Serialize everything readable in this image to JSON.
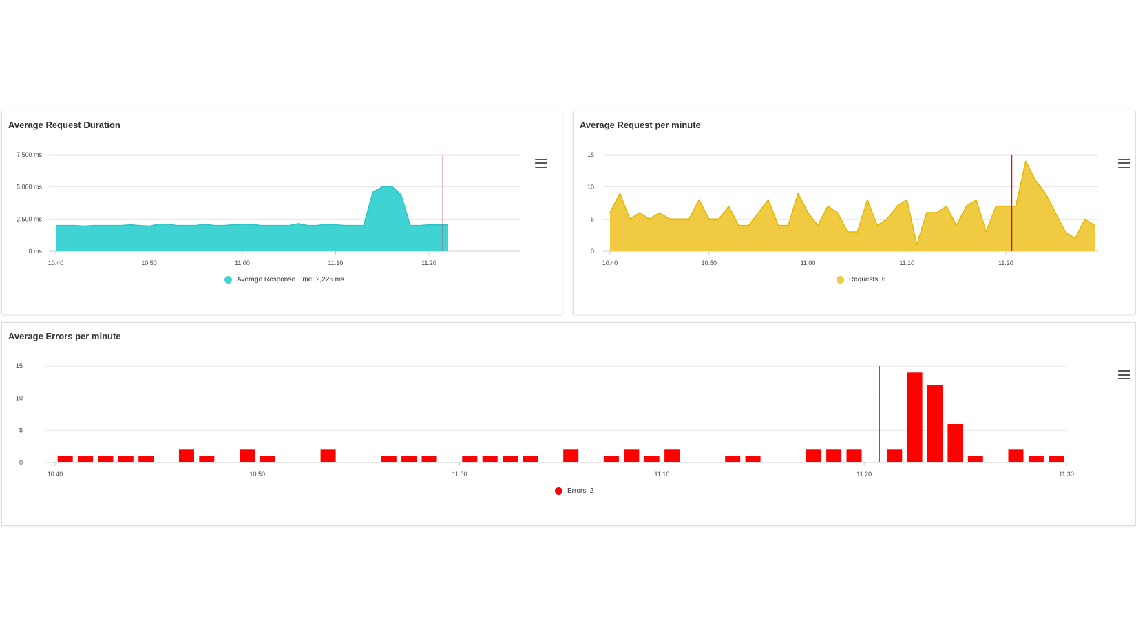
{
  "charts": {
    "duration": {
      "title": "Average Request Duration",
      "legend_label": "Average Response Time: 2,225 ms",
      "color": "#3fd3d3",
      "stroke": "#2cc4c4"
    },
    "requests": {
      "title": "Average Request per minute",
      "legend_label": "Requests: 6",
      "color": "#f0cb41",
      "stroke": "#e3b900"
    },
    "errors": {
      "title": "Average Errors per minute",
      "legend_label": "Errors: 2",
      "color": "#ff0000",
      "stroke": "#ff0000"
    },
    "marker_color": "#e8000c",
    "grid_color": "#e6e6e6"
  },
  "chart_data": [
    {
      "type": "area",
      "title": "Average Request Duration",
      "series": [
        {
          "name": "Average Response Time",
          "values": [
            2000,
            2000,
            2000,
            1950,
            2000,
            2000,
            2000,
            2000,
            2050,
            2000,
            1950,
            2100,
            2100,
            2000,
            2000,
            2000,
            2100,
            2000,
            2000,
            2050,
            2100,
            2100,
            2000,
            2000,
            2000,
            2000,
            2150,
            2000,
            2000,
            2100,
            2050,
            2000,
            2000,
            2000,
            4600,
            5000,
            5050,
            4400,
            2000,
            2000,
            2050,
            2050,
            2050
          ]
        }
      ],
      "x_start_minutes": 640,
      "x_step_minutes": 1,
      "x_ticks": [
        "10:40",
        "10:50",
        "11:00",
        "11:10",
        "11:20"
      ],
      "y_ticks": [
        "0 ms",
        "2,500 ms",
        "5,000 ms",
        "7,500 ms"
      ],
      "ylim": [
        0,
        7500
      ],
      "xlim_minutes": [
        640,
        690
      ],
      "marker_minutes": 681.5,
      "grid": true,
      "legend_placement": "bottom-center"
    },
    {
      "type": "area",
      "title": "Average Request per minute",
      "series": [
        {
          "name": "Requests",
          "values": [
            6,
            9,
            5,
            6,
            5,
            6,
            5,
            5,
            5,
            8,
            5,
            5,
            7,
            4,
            4,
            6,
            8,
            4,
            4,
            9,
            6,
            4,
            7,
            6,
            3,
            3,
            8,
            4,
            5,
            7,
            8,
            1,
            6,
            6,
            7,
            4,
            7,
            8,
            3,
            7,
            7,
            7,
            14,
            11,
            9,
            6,
            3,
            2,
            5,
            4
          ]
        }
      ],
      "x_start_minutes": 640,
      "x_step_minutes": 1,
      "x_ticks": [
        "10:40",
        "10:50",
        "11:00",
        "11:10",
        "11:20"
      ],
      "y_ticks": [
        "0",
        "5",
        "10",
        "15"
      ],
      "ylim": [
        0,
        15
      ],
      "xlim_minutes": [
        640,
        689
      ],
      "marker_minutes": 680.6,
      "grid": true,
      "legend_placement": "bottom-center"
    },
    {
      "type": "bar",
      "title": "Average Errors per minute",
      "series": [
        {
          "name": "Errors",
          "values": [
            1,
            1,
            1,
            1,
            1,
            0,
            2,
            1,
            0,
            2,
            1,
            0,
            0,
            2,
            0,
            0,
            1,
            1,
            1,
            0,
            1,
            1,
            1,
            1,
            0,
            2,
            0,
            1,
            2,
            1,
            2,
            0,
            0,
            1,
            1,
            0,
            0,
            2,
            2,
            2,
            0,
            2,
            14,
            12,
            6,
            1,
            0,
            2,
            1,
            1
          ]
        }
      ],
      "x_start_minutes": 640,
      "x_step_minutes": 1,
      "x_ticks": [
        "10:40",
        "10:50",
        "11:00",
        "11:10",
        "11:20",
        "11:30"
      ],
      "y_ticks": [
        "0",
        "5",
        "10",
        "15"
      ],
      "ylim": [
        0,
        15
      ],
      "xlim_minutes": [
        640,
        690
      ],
      "marker_minutes": 680.75,
      "grid": true,
      "legend_placement": "bottom-center"
    }
  ]
}
